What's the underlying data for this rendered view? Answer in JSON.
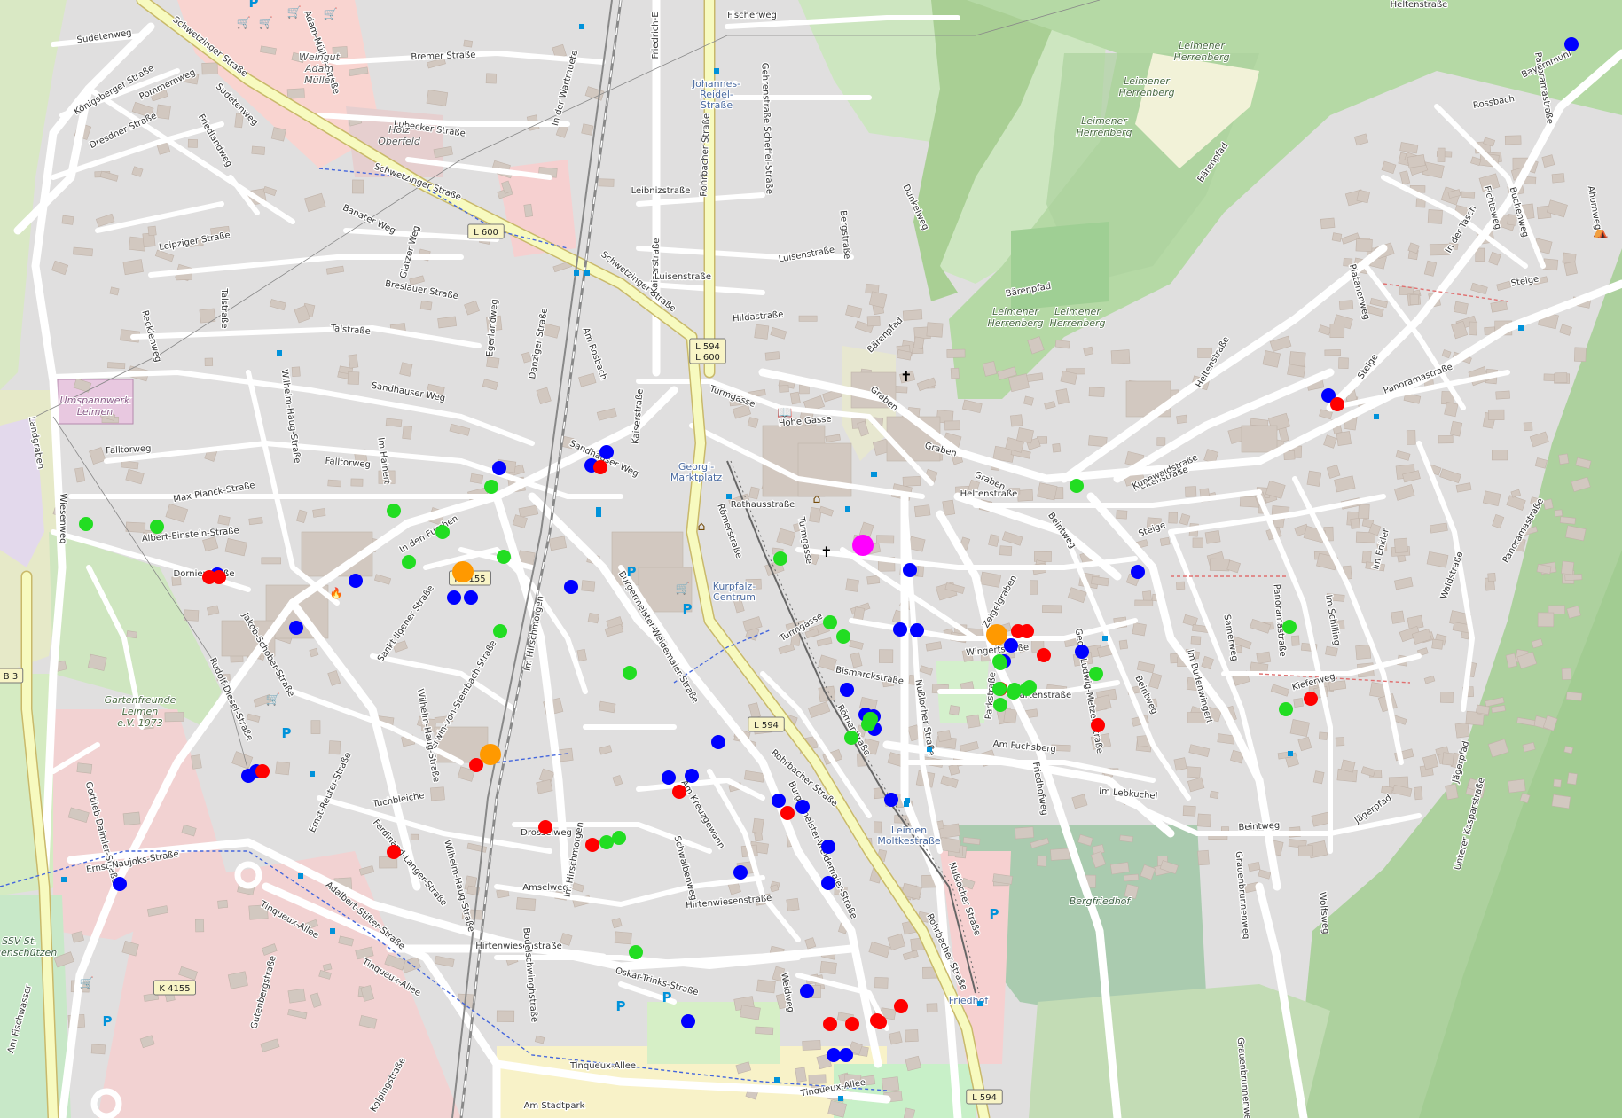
{
  "colors": {
    "background": "#e0dfdf",
    "road_minor": "#ffffff",
    "road_major": "#f7fabf",
    "road_major_casing": "#c9b96a",
    "railway": "#999999",
    "forest": "#add19e",
    "park": "#c8facc",
    "farmland": "#eef0d5",
    "vineyard": "#b3e2a8",
    "cemetery": "#aacbaf",
    "industrial": "#ebdbe8",
    "retail": "#ffd6d1",
    "building": "#d9d0c9",
    "marker_blue": "#0000ff",
    "marker_red": "#ff0000",
    "marker_green": "#22dd22",
    "marker_orange": "#ff9900",
    "marker_magenta": "#ff00ff"
  },
  "street_labels": [
    {
      "id": "sudetenweg",
      "text": "Sudetenweg"
    },
    {
      "id": "schwetzinger-1",
      "text": "Schwetzinger Straße"
    },
    {
      "id": "schwetzinger-2",
      "text": "Schwetzinger Straße"
    },
    {
      "id": "schwetzinger-3",
      "text": "Schwetzinger Straße"
    },
    {
      "id": "adam-mueller",
      "text": "Adam-Müller-Straße"
    },
    {
      "id": "bremer",
      "text": "Bremer Straße"
    },
    {
      "id": "koenigsberger",
      "text": "Königsberger Straße"
    },
    {
      "id": "pommernweg",
      "text": "Pommernweg"
    },
    {
      "id": "sudetenweg-2",
      "text": "Sudetenweg"
    },
    {
      "id": "friedlandweg",
      "text": "Friedlandweg"
    },
    {
      "id": "dresdner",
      "text": "Dresdner Straße"
    },
    {
      "id": "lubecker",
      "text": "Lubecker Straße"
    },
    {
      "id": "in-der-wartmuete",
      "text": "In der Wartmuete"
    },
    {
      "id": "friedrich-ebert",
      "text": "Friedrich-E"
    },
    {
      "id": "fischerweg",
      "text": "Fischerweg"
    },
    {
      "id": "rohrbacher-1",
      "text": "Rohrbacher Straße"
    },
    {
      "id": "gehrenstrasse",
      "text": "Gehrenstraße Scheffel-Straße"
    },
    {
      "id": "leibnizstrasse",
      "text": "Leibnizstraße"
    },
    {
      "id": "kaiserstrasse",
      "text": "Kaiserstraße"
    },
    {
      "id": "bergstrasse",
      "text": "Bergstraße"
    },
    {
      "id": "dunkelweg",
      "text": "Dunkelweg"
    },
    {
      "id": "luisenstrasse-1",
      "text": "Luisenstraße"
    },
    {
      "id": "luisenstrasse-2",
      "text": "Luisenstraße"
    },
    {
      "id": "hildastrasse",
      "text": "Hildastraße"
    },
    {
      "id": "leipziger",
      "text": "Leipziger Straße"
    },
    {
      "id": "banater",
      "text": "Banater Weg"
    },
    {
      "id": "glatzer",
      "text": "Glatzer Weg"
    },
    {
      "id": "breslauer",
      "text": "Breslauer Straße"
    },
    {
      "id": "egerlandweg",
      "text": "Egerlandweg"
    },
    {
      "id": "danziger",
      "text": "Danziger Straße"
    },
    {
      "id": "am-rosbach",
      "text": "Am Rosbach"
    },
    {
      "id": "talstrasse-1",
      "text": "Talstraße"
    },
    {
      "id": "talstrasse-2",
      "text": "Talstraße"
    },
    {
      "id": "reckienweg",
      "text": "Reckienweg"
    },
    {
      "id": "sandhauser-1",
      "text": "Sandhauser Weg"
    },
    {
      "id": "sandhauser-2",
      "text": "Sandhauser Weg"
    },
    {
      "id": "kaiserstrasse-2",
      "text": "Kaiserstraße"
    },
    {
      "id": "turmgasse-1",
      "text": "Turmgasse"
    },
    {
      "id": "hohe-gasse",
      "text": "Hohe Gasse"
    },
    {
      "id": "baerenpfad-1",
      "text": "Bärenpfad"
    },
    {
      "id": "graben-1",
      "text": "Graben"
    },
    {
      "id": "graben-2",
      "text": "Graben"
    },
    {
      "id": "graben-3",
      "text": "Graben"
    },
    {
      "id": "falltorweg-1",
      "text": "Falltorweg"
    },
    {
      "id": "falltorweg-2",
      "text": "Falltorweg"
    },
    {
      "id": "wilhelm-haug-1",
      "text": "Wilhelm-Haug-Straße"
    },
    {
      "id": "im-hainert",
      "text": "Im Hainert"
    },
    {
      "id": "max-planck",
      "text": "Max-Planck-Straße"
    },
    {
      "id": "albert-einstein",
      "text": "Albert-Einstein-Straße"
    },
    {
      "id": "wiesenweg",
      "text": "Wiesenweg"
    },
    {
      "id": "in-den-furchen",
      "text": "In den Furchen"
    },
    {
      "id": "dornierstrasse",
      "text": "Dornierstraße"
    },
    {
      "id": "rathausstrasse",
      "text": "Rathausstraße"
    },
    {
      "id": "roemerstrasse-1",
      "text": "Römerstraße"
    },
    {
      "id": "turmgasse-2",
      "text": "Turmgasse"
    },
    {
      "id": "turmgasse-3",
      "text": "Turmgasse"
    },
    {
      "id": "heltenstrasse-1",
      "text": "Heltenstraße"
    },
    {
      "id": "heltenstrasse-2",
      "text": "Heltenstraße"
    },
    {
      "id": "heltenstrasse-3",
      "text": "Heltenstraße"
    },
    {
      "id": "heltenstrasse-4",
      "text": "Heltenstraße"
    },
    {
      "id": "sankt-ilgener",
      "text": "Sankt Ilgener Straße"
    },
    {
      "id": "jakob-schober",
      "text": "Jakob-Schober-Straße"
    },
    {
      "id": "rudolf-diesel",
      "text": "Rudolf-Diesel-Straße"
    },
    {
      "id": "im-hirschmorgen-1",
      "text": "Im Hirschmorgen"
    },
    {
      "id": "burgermeister-1",
      "text": "Burgermeister-Weidemaier-Straße"
    },
    {
      "id": "erwin-von-steinbach",
      "text": "Erwin-von-Steinbach-Straße"
    },
    {
      "id": "wilhelm-haug-2",
      "text": "Wilhelm-Haug-Straße"
    },
    {
      "id": "zeigelgraben",
      "text": "Zeigelgraben"
    },
    {
      "id": "wingertstrasse",
      "text": "Wingertstraße"
    },
    {
      "id": "bismarckstrasse",
      "text": "Bismarckstraße"
    },
    {
      "id": "roemerstrasse-2",
      "text": "Römerstraße"
    },
    {
      "id": "nussloecher-1",
      "text": "Nußlocher Straße"
    },
    {
      "id": "parkstrasse",
      "text": "Parkstraße"
    },
    {
      "id": "gartenstrasse",
      "text": "Gartenstraße"
    },
    {
      "id": "georg-ludwig-metzer",
      "text": "Georg-Ludwig-Metzer-Straße"
    },
    {
      "id": "am-fuchsberg",
      "text": "Am Fuchsberg"
    },
    {
      "id": "friedhofweg",
      "text": "Friedhofweg"
    },
    {
      "id": "im-lebkuchel",
      "text": "Im Lebkuchel"
    },
    {
      "id": "beintweg-1",
      "text": "Beintweg"
    },
    {
      "id": "beintweg-2",
      "text": "Beintweg"
    },
    {
      "id": "beintweg-3",
      "text": "Beintweg"
    },
    {
      "id": "samerweg",
      "text": "Samerweg"
    },
    {
      "id": "kunewaldstrasse",
      "text": "Kunewaldstraße"
    },
    {
      "id": "steige-1",
      "text": "Steige"
    },
    {
      "id": "steige-2",
      "text": "Steige"
    },
    {
      "id": "steige-3",
      "text": "Steige"
    },
    {
      "id": "im-budenwingert",
      "text": "Im Budenwingert"
    },
    {
      "id": "panoramastrasse-1",
      "text": "Panoramastraße"
    },
    {
      "id": "panoramastrasse-2",
      "text": "Panoramastraße"
    },
    {
      "id": "panoramastrasse-3",
      "text": "Panoramastraße"
    },
    {
      "id": "panoramastrasse-4",
      "text": "Panoramastraße"
    },
    {
      "id": "im-schilling",
      "text": "Im Schilling"
    },
    {
      "id": "im-enkler",
      "text": "Im Enkler"
    },
    {
      "id": "waldstrasse",
      "text": "Waldstraße"
    },
    {
      "id": "kieferweg",
      "text": "Kieferweg"
    },
    {
      "id": "jaegerpfad-1",
      "text": "Jägerpfad"
    },
    {
      "id": "jaegerpfad-2",
      "text": "Jägerpfad"
    },
    {
      "id": "in-der-tasch",
      "text": "In der Tasch"
    },
    {
      "id": "fichteweg",
      "text": "Fichteweg"
    },
    {
      "id": "buchenweg",
      "text": "Buchenweg"
    },
    {
      "id": "ahornweg",
      "text": "Ahornweg"
    },
    {
      "id": "bayernmuhl",
      "text": "Bayernmuhl"
    },
    {
      "id": "barenpfad-2",
      "text": "Bärenpfad"
    },
    {
      "id": "barenpfad-3",
      "text": "Bärenpfad"
    },
    {
      "id": "platanenweg",
      "text": "Platanenweg"
    },
    {
      "id": "ernst-reuter",
      "text": "Ernst-Reuter-Straße"
    },
    {
      "id": "tuchbleiche",
      "text": "Tuchbleiche"
    },
    {
      "id": "ferdinand-langer",
      "text": "Ferdinand-Langer-Straße"
    },
    {
      "id": "wilhelm-haug-3",
      "text": "Wilhelm-Haug-Straße"
    },
    {
      "id": "gottlieb-daimler",
      "text": "Gottlieb-Daimler-Straße"
    },
    {
      "id": "ernst-naujoks",
      "text": "Ernst-Naujoks-Straße"
    },
    {
      "id": "tinqueux-1",
      "text": "Tinqueux-Allee"
    },
    {
      "id": "tinqueux-2",
      "text": "Tinqueux-Allee"
    },
    {
      "id": "tinqueux-3",
      "text": "Tinqueux-Allee"
    },
    {
      "id": "tinqueux-4",
      "text": "Tinqueux-Allee"
    },
    {
      "id": "adalbert-stifter",
      "text": "Adalbert-Stifter-Straße"
    },
    {
      "id": "drosselweg",
      "text": "Drosselweg"
    },
    {
      "id": "amselweg",
      "text": "Amselweg"
    },
    {
      "id": "im-hirschmorgen-2",
      "text": "Im Hirschmorgen"
    },
    {
      "id": "am-kreuzgewann",
      "text": "Am Kreuzgewann"
    },
    {
      "id": "schwalbenweg",
      "text": "Schwalbenweg"
    },
    {
      "id": "burgermeister-2",
      "text": "Burgermeister-Weidemaier-Straße"
    },
    {
      "id": "hirtenwiesen-1",
      "text": "Hirtenwiesenstraße"
    },
    {
      "id": "hirtenwiesen-2",
      "text": "Hirtenwiesenstraße"
    },
    {
      "id": "bodelschwingh",
      "text": "Bodelschwinghstraße"
    },
    {
      "id": "oskar-trinks",
      "text": "Oskar-Trinks-Straße"
    },
    {
      "id": "weidweg",
      "text": "Weidweg"
    },
    {
      "id": "gutenbergstrasse",
      "text": "Gutenbergstraße"
    },
    {
      "id": "kolpingstrasse",
      "text": "Kolpingstraße"
    },
    {
      "id": "am-stadtpark",
      "text": "Am Stadtpark"
    },
    {
      "id": "rohrbacher-2",
      "text": "Rohrbacher Straße"
    },
    {
      "id": "rohrbacher-3",
      "text": "Rohrbacher Straße"
    },
    {
      "id": "nussloecher-2",
      "text": "Nußlocher Straße"
    },
    {
      "id": "wolfsweg",
      "text": "Wolfsweg"
    },
    {
      "id": "grauenbrunnenweg-1",
      "text": "Grauenbrunnenweg"
    },
    {
      "id": "grauenbrunnenweg-2",
      "text": "Grauenbrunnenweg"
    },
    {
      "id": "unterer-kaspar",
      "text": "Unterer Kasparstraße"
    },
    {
      "id": "in-der-tasch-2",
      "text": "Rossbach"
    },
    {
      "id": "am-fischwasser",
      "text": "Am Fischwasser"
    },
    {
      "id": "landgraben",
      "text": "Landgraben"
    }
  ],
  "place_labels": [
    {
      "id": "weingut",
      "lines": [
        "Weingut",
        "Adam",
        "Müller"
      ]
    },
    {
      "id": "holz-oberfeld",
      "lines": [
        "Holz",
        "Oberfeld"
      ]
    },
    {
      "id": "umspannwerk",
      "lines": [
        "Umspannwerk",
        "Leimen"
      ]
    },
    {
      "id": "gartenfreunde",
      "lines": [
        "Gartenfreunde",
        "Leimen",
        "e.V. 1973"
      ]
    },
    {
      "id": "leimener-herrenberg",
      "lines": [
        "Leimener",
        "Herrenberg"
      ]
    },
    {
      "id": "leimener-herrenberg-2",
      "lines": [
        "Leimener",
        "Herrenberg"
      ]
    },
    {
      "id": "leimener-herrenberg-3",
      "lines": [
        "Leimener",
        "Herrenberg"
      ]
    },
    {
      "id": "leimener-herrenberg-4",
      "lines": [
        "Leimener",
        "Herrenberg"
      ]
    },
    {
      "id": "leimener-herrenberg-5",
      "lines": [
        "Leimener",
        "Herrenberg"
      ]
    },
    {
      "id": "bergfriedhof",
      "lines": [
        "Bergfriedhof"
      ]
    },
    {
      "id": "ssv-bogenschuetzen",
      "lines": [
        "SSV St.",
        "Bogenschützen"
      ]
    }
  ],
  "transit_labels": [
    {
      "id": "johannes-reidel",
      "lines": [
        "Johannes-",
        "Reidel-",
        "Straße"
      ]
    },
    {
      "id": "georgi-marktplatz",
      "lines": [
        "Georgi-",
        "Marktplatz"
      ]
    },
    {
      "id": "kurpfalz-centrum",
      "lines": [
        "Kurpfalz-",
        "Centrum"
      ]
    },
    {
      "id": "leimen-moltkestrasse",
      "lines": [
        "Leimen",
        "Moltkestraße"
      ]
    },
    {
      "id": "friedhof",
      "lines": [
        "Friedhof"
      ]
    }
  ],
  "road_shields": [
    {
      "id": "l600-a",
      "text": "L 600"
    },
    {
      "id": "l594-l600",
      "text": "L 594",
      "text2": "L 600"
    },
    {
      "id": "k4155-a",
      "text": "K 4155"
    },
    {
      "id": "l594-b",
      "text": "L 594"
    },
    {
      "id": "k4155-b",
      "text": "K 4155"
    },
    {
      "id": "l594-c",
      "text": "L 594"
    },
    {
      "id": "b3",
      "text": "B 3"
    }
  ],
  "markers": {
    "blue": 44,
    "red": 28,
    "green": 33,
    "orange": 3,
    "magenta": 1
  },
  "icons": [
    "church-icon",
    "shopping-cart-icon",
    "parking-icon",
    "bus-stop-icon",
    "library-icon",
    "town-hall-icon",
    "fire-station-icon",
    "picnic-icon"
  ]
}
